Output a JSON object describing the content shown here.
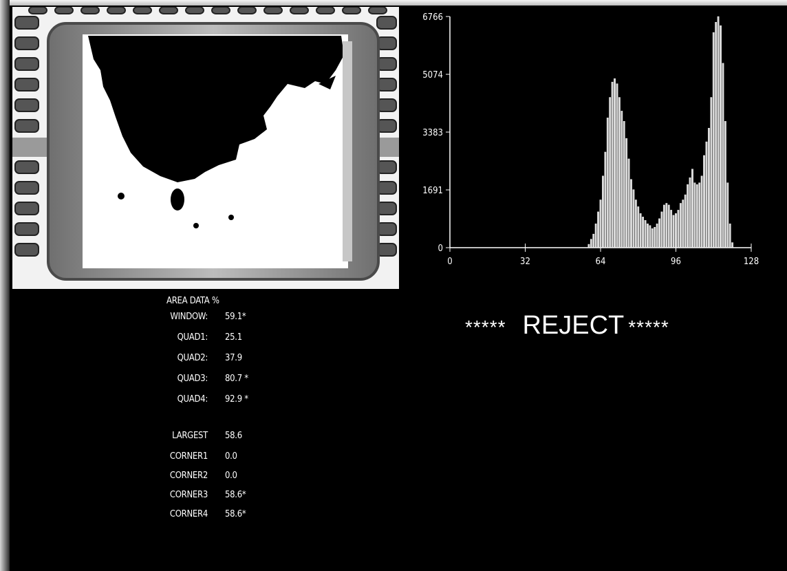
{
  "histogram": {
    "y_ticks": [
      "6766",
      "5074",
      "3383",
      "1691",
      "0"
    ],
    "x_ticks": [
      "0",
      "32",
      "64",
      "96",
      "128"
    ]
  },
  "chart_data": {
    "type": "bar",
    "xlim": [
      0,
      128
    ],
    "ylim": [
      0,
      6766
    ],
    "x": [
      59,
      60,
      61,
      62,
      63,
      64,
      65,
      66,
      67,
      68,
      69,
      70,
      71,
      72,
      73,
      74,
      75,
      76,
      77,
      78,
      79,
      80,
      81,
      82,
      83,
      84,
      85,
      86,
      87,
      88,
      89,
      90,
      91,
      92,
      93,
      94,
      95,
      96,
      97,
      98,
      99,
      100,
      101,
      102,
      103,
      104,
      105,
      106,
      107,
      108,
      109,
      110,
      111,
      112,
      113,
      114,
      115,
      116,
      117,
      118,
      119,
      120
    ],
    "values": [
      100,
      250,
      400,
      700,
      1050,
      1400,
      2100,
      2800,
      3800,
      4400,
      4850,
      4950,
      4800,
      4400,
      4000,
      3700,
      3200,
      2600,
      2000,
      1700,
      1400,
      1200,
      1000,
      900,
      800,
      700,
      650,
      560,
      600,
      700,
      850,
      1050,
      1250,
      1300,
      1250,
      1100,
      950,
      1000,
      1100,
      1300,
      1400,
      1550,
      1850,
      2050,
      2300,
      1900,
      1850,
      1900,
      2100,
      2700,
      3100,
      3500,
      4400,
      6300,
      6600,
      6766,
      6500,
      5400,
      3700,
      1900,
      700,
      150
    ]
  },
  "area_data": {
    "heading": "AREA DATA  %",
    "rows": [
      {
        "label": "WINDOW:",
        "value": "59.1*"
      },
      {
        "label": "QUAD1:",
        "value": "25.1"
      },
      {
        "label": "QUAD2:",
        "value": "37.9"
      },
      {
        "label": "QUAD3:",
        "value": "80.7 *"
      },
      {
        "label": "QUAD4:",
        "value": "92.9 *"
      },
      {
        "label": "LARGEST",
        "value": "58.6"
      },
      {
        "label": "CORNER1",
        "value": "0.0"
      },
      {
        "label": "CORNER2",
        "value": "0.0"
      },
      {
        "label": "CORNER3",
        "value": "58.6*"
      },
      {
        "label": "CORNER4",
        "value": "58.6*"
      }
    ]
  },
  "verdict": {
    "stars_left": "*****",
    "text": "REJECT",
    "stars_right": "*****"
  }
}
